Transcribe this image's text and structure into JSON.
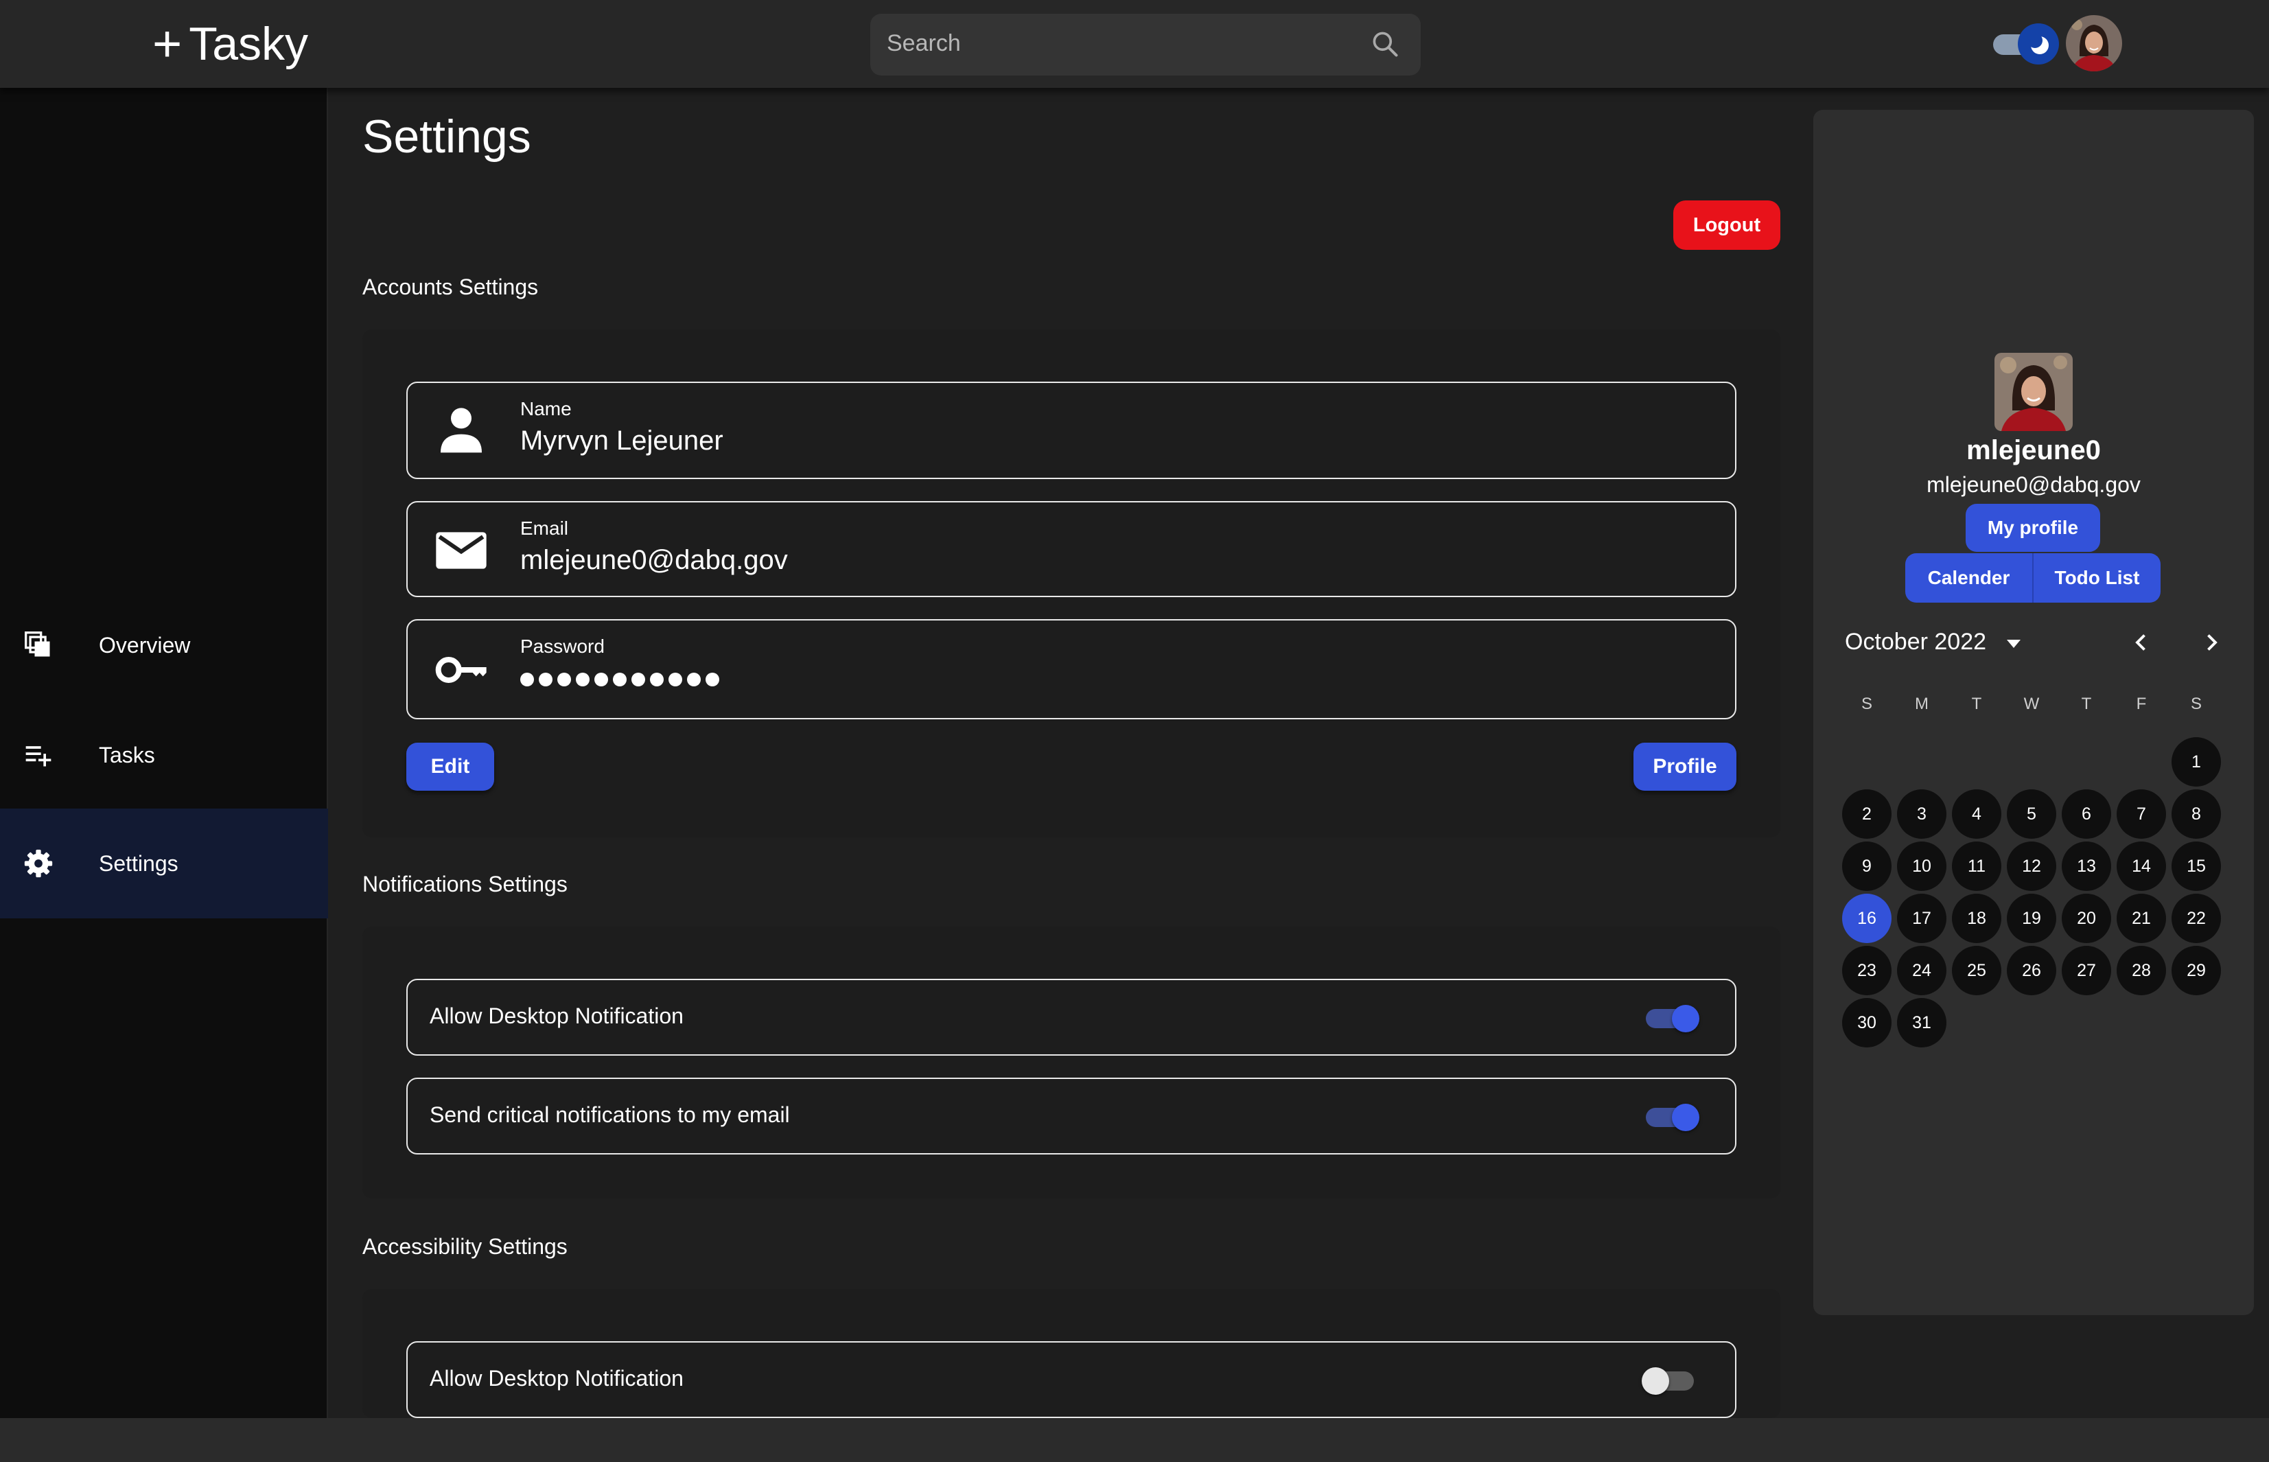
{
  "app": {
    "brand_plus": "+",
    "brand_name": "Tasky"
  },
  "search": {
    "placeholder": "Search"
  },
  "sidebar": {
    "items": [
      {
        "label": "Overview",
        "icon": "overview-icon"
      },
      {
        "label": "Tasks",
        "icon": "playlist-add-icon"
      },
      {
        "label": "Settings",
        "icon": "gear-icon",
        "active": true
      }
    ]
  },
  "page": {
    "title": "Settings",
    "logout_label": "Logout"
  },
  "accounts": {
    "heading": "Accounts Settings",
    "name_label": "Name",
    "name_value": "Myrvyn Lejeuner",
    "email_label": "Email",
    "email_value": "mlejeune0@dabq.gov",
    "password_label": "Password",
    "password_dot_count": 11,
    "edit_label": "Edit",
    "profile_label": "Profile"
  },
  "notifications": {
    "heading": "Notifications Settings",
    "items": [
      {
        "label": "Allow Desktop Notification",
        "on": true
      },
      {
        "label": "Send critical notifications to my email",
        "on": true
      }
    ]
  },
  "accessibility": {
    "heading": "Accessibility Settings",
    "items": [
      {
        "label": "Allow Desktop Notification",
        "on": false
      }
    ]
  },
  "profile_card": {
    "username": "mlejeune0",
    "email": "mlejeune0@dabq.gov",
    "my_profile_label": "My profile",
    "tab_calendar": "Calender",
    "tab_todo": "Todo List"
  },
  "calendar": {
    "month_label": "October 2022",
    "weekdays": [
      "S",
      "M",
      "T",
      "W",
      "T",
      "F",
      "S"
    ],
    "first_weekday_index": 6,
    "days_in_month": 31,
    "selected_day": 16
  },
  "colors": {
    "accent": "#3352d9",
    "danger": "#e8121a",
    "background": "#1f1f1f",
    "sidebar": "#0d0d0d"
  }
}
